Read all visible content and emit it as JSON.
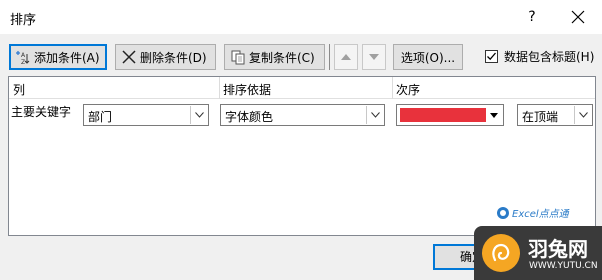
{
  "window": {
    "title": "排序",
    "help_label": "?"
  },
  "toolbar": {
    "add_label": "添加条件(A)",
    "delete_label": "删除条件(D)",
    "copy_label": "复制条件(C)",
    "options_label": "选项(O)...",
    "header_checkbox_label": "数据包含标题(H)",
    "header_checkbox_checked": true
  },
  "grid": {
    "headers": {
      "column": "列",
      "sort_on": "排序依据",
      "order": "次序"
    },
    "rows": [
      {
        "label": "主要关键字",
        "column_value": "部门",
        "sort_on_value": "字体颜色",
        "color_value": "#e8323c",
        "position_value": "在顶端"
      }
    ]
  },
  "watermark": {
    "text": "Excel点点通"
  },
  "footer": {
    "ok_label": "确定"
  },
  "brand": {
    "name": "羽兔网",
    "url": "WWW.YUTU.CN",
    "color": "#f5a623"
  }
}
